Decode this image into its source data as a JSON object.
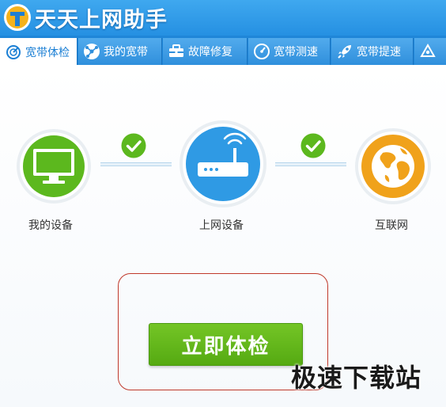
{
  "app": {
    "title": "天天上网助手"
  },
  "tabs": [
    {
      "label": "宽带体检",
      "icon": "radar-icon",
      "active": true
    },
    {
      "label": "我的宽带",
      "icon": "network-icon",
      "active": false
    },
    {
      "label": "故障修复",
      "icon": "toolbox-icon",
      "active": false
    },
    {
      "label": "宽带测速",
      "icon": "speedometer-icon",
      "active": false
    },
    {
      "label": "宽带提速",
      "icon": "rocket-icon",
      "active": false
    },
    {
      "label": "",
      "icon": "more-icon",
      "active": false
    }
  ],
  "nodes": {
    "my_device": {
      "label": "我的设备",
      "icon": "monitor-icon",
      "color": "#5cb81e"
    },
    "network_device": {
      "label": "上网设备",
      "icon": "router-icon",
      "color": "#2f9ae4"
    },
    "internet": {
      "label": "互联网",
      "icon": "globe-icon",
      "color": "#f0a21b"
    }
  },
  "status": {
    "link1": "ok",
    "link2": "ok",
    "check_color": "#5cb81e"
  },
  "actions": {
    "check_now": "立即体检"
  },
  "watermark": "极速下载站",
  "colors": {
    "header": "#2a94e4",
    "accent": "#5cb81e",
    "highlight_border": "#c0392b"
  }
}
